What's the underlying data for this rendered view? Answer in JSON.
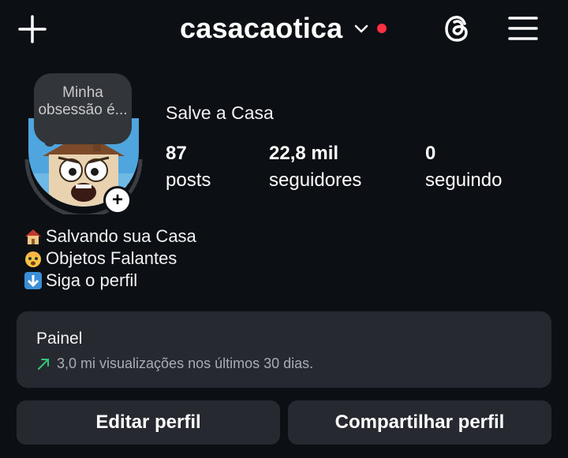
{
  "header": {
    "username": "casacaotica",
    "icons": [
      "plus-icon",
      "chevron-down-icon",
      "notification-dot",
      "threads-icon",
      "menu-icon"
    ],
    "notification_color": "#ff3040"
  },
  "profile": {
    "note": "Minha obsessão é...",
    "display_name": "Salve a Casa",
    "stats": [
      {
        "value": "87",
        "label": "posts"
      },
      {
        "value": "22,8 mil",
        "label": "seguidores"
      },
      {
        "value": "0",
        "label": "seguindo"
      }
    ],
    "bio": [
      {
        "emoji": "house-emoji",
        "text": "Salvando sua Casa"
      },
      {
        "emoji": "shocked-face-emoji",
        "text": " Objetos Falantes"
      },
      {
        "emoji": "down-arrow-emoji",
        "text": "Siga o perfil"
      }
    ]
  },
  "dashboard": {
    "title": "Painel",
    "summary": "3,0 mi visualizações nos últimos 30 dias."
  },
  "actions": {
    "edit_label": "Editar perfil",
    "share_label": "Compartilhar perfil"
  }
}
